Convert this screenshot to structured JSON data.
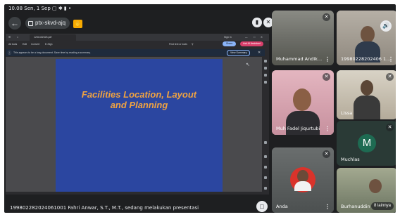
{
  "status_bar": {
    "text": "10.08 Sen, 1 Sep ▢ ✱ ▮ •"
  },
  "meeting": {
    "code": "ptx-skvd-ajq",
    "back_icon": "back-arrow-icon",
    "yellow_icon": "hand-icon"
  },
  "browser": {
    "tab_title": "1231432323.pdf",
    "toolbar_items": [
      "All tools",
      "Edit",
      "Convert",
      "E-Sign"
    ],
    "find_text": "Find text or tools",
    "share_label": "Share",
    "ask_label": "Ask AI Assistant",
    "sign_in": "Sign in",
    "info_text": "This appears to be a long document. Save time by reading a summary.",
    "summary_button": "View Summary"
  },
  "slide": {
    "title_line1": "Facilities Location, Layout",
    "title_line2": "and Planning"
  },
  "presenter": {
    "text": "19980228202406100​1 Fahri Anwar, S.T., M.T., sedang melakukan presentasi"
  },
  "participants": [
    {
      "name": "Muhammad Andik...",
      "muted": true
    },
    {
      "name": "19980228202406 1...",
      "muted": false
    },
    {
      "name": "Muh Fadel Jiqurtubi",
      "muted": true
    },
    {
      "name": "Lissa",
      "muted": true
    },
    {
      "name": "Muchlas",
      "muted": true,
      "initial": "M"
    },
    {
      "name": "Anda",
      "muted": true
    },
    {
      "name": "Burhanuddin",
      "muted": false,
      "others": "8 lainnya"
    }
  ],
  "colors": {
    "slide_bg": "#2b46a0",
    "slide_title": "#f0a341",
    "avatar_m": "#1e6b52"
  }
}
